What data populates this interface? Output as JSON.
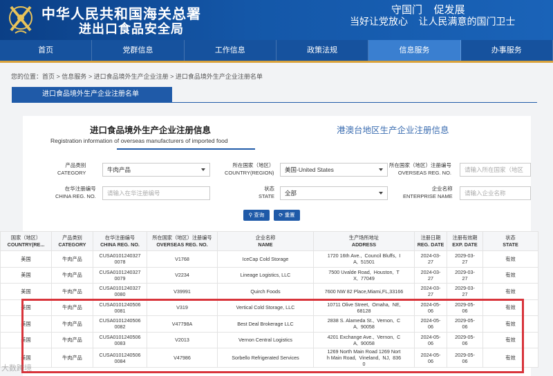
{
  "header": {
    "title_main": "中华人民共和国海关总署",
    "title_sub": "进出口食品安全局",
    "slogan_1": "守国门    促发展",
    "slogan_2": "当好让党放心    让人民满意的国门卫士"
  },
  "nav": {
    "items": [
      "首页",
      "党群信息",
      "工作信息",
      "政策法规",
      "信息服务",
      "办事服务"
    ],
    "active_index": 4
  },
  "breadcrumb": {
    "prefix": "您的位置：",
    "items": [
      "首页",
      "信息服务",
      "进口食品境外生产企业注册",
      "进口食品境外生产企业注册名单"
    ],
    "separator": " > "
  },
  "tab_title": "进口食品境外生产企业注册名单",
  "panel": {
    "tab_active_cn": "进口食品境外生产企业注册信息",
    "tab_active_en": "Registration information of overseas manufacturers of imported food",
    "tab_other": "港澳台地区生产企业注册信息"
  },
  "form": {
    "category_label_cn": "产品类别",
    "category_label_en": "CATEGORY",
    "category_value": "牛肉产品",
    "country_label_cn": "所在国家（地区）",
    "country_label_en": "COUNTRY(REGION)",
    "country_value": "美国-United States",
    "overseas_label_cn": "所在国家（地区）注册编号",
    "overseas_label_en": "OVERSEAS REG. NO.",
    "overseas_placeholder": "请输入所在国家（地区",
    "china_label_cn": "在华注册编号",
    "china_label_en": "CHINA REG. NO.",
    "china_placeholder": "请输入在华注册编号",
    "state_label_cn": "状态",
    "state_label_en": "STATE",
    "state_value": "全部",
    "enterprise_label_cn": "企业名称",
    "enterprise_label_en": "ENTERPRISE NAME",
    "enterprise_placeholder": "请输入企业名称",
    "search_button": "查询",
    "reset_button": "重置"
  },
  "table": {
    "headers": [
      {
        "cn": "国家（地区）",
        "en": "COUNTRY(RE..."
      },
      {
        "cn": "产品类别",
        "en": "CATEGORY"
      },
      {
        "cn": "在华注册编号",
        "en": "CHINA REG. NO."
      },
      {
        "cn": "所在国家（地区）注册编号",
        "en": "OVERSEAS REG. NO."
      },
      {
        "cn": "企业名称",
        "en": "NAME"
      },
      {
        "cn": "生产场所地址",
        "en": "ADDRESS"
      },
      {
        "cn": "注册日期",
        "en": "REG. DATE"
      },
      {
        "cn": "注册有效期",
        "en": "EXP. DATE"
      },
      {
        "cn": "状态",
        "en": "STATE"
      }
    ],
    "rows": [
      {
        "country": "美国",
        "category": "牛肉产品",
        "china_reg": "CUSA0101240327\n0078",
        "overseas_reg": "V1768",
        "name": "IceCap Cold Storage",
        "address": "1720 16th Ave.,  Council Bluffs,  I\nA,  51501",
        "reg_date": "2024-03-\n27",
        "exp_date": "2029-03-\n27",
        "state": "有效"
      },
      {
        "country": "美国",
        "category": "牛肉产品",
        "china_reg": "CUSA0101240327\n0079",
        "overseas_reg": "V2234",
        "name": "Lineage Logistics, LLC",
        "address": "7500 Uvalde Road,  Houston,  T\nX,  77049",
        "reg_date": "2024-03-\n27",
        "exp_date": "2029-03-\n27",
        "state": "有效"
      },
      {
        "country": "美国",
        "category": "牛肉产品",
        "china_reg": "CUSA0101240327\n0080",
        "overseas_reg": "V39991",
        "name": "Quirch Foods",
        "address": "7600 NW 82 Place,Miami,FL,33166",
        "reg_date": "2024-03-\n27",
        "exp_date": "2029-03-\n27",
        "state": "有效"
      },
      {
        "country": "美国",
        "category": "牛肉产品",
        "china_reg": "CUSA0101240506\n0081",
        "overseas_reg": "V319",
        "name": "Vertical Cold Storage, LLC",
        "address": "10711 Olive Street,  Omaha,  NE,\n68128",
        "reg_date": "2024-05-\n06",
        "exp_date": "2029-05-\n06",
        "state": "有效"
      },
      {
        "country": "美国",
        "category": "牛肉产品",
        "china_reg": "CUSA0101240506\n0082",
        "overseas_reg": "V47798A",
        "name": "Best Deal Brokerage LLC",
        "address": "2838 S. Alameda St.,  Vernon,  C\nA,  90058",
        "reg_date": "2024-05-\n06",
        "exp_date": "2029-05-\n06",
        "state": "有效"
      },
      {
        "country": "美国",
        "category": "牛肉产品",
        "china_reg": "CUSA0101240506\n0083",
        "overseas_reg": "V2013",
        "name": "Vernon Central Logistics",
        "address": "4201 Exchange Ave.,  Vernon,  C\nA,  90058",
        "reg_date": "2024-05-\n06",
        "exp_date": "2029-05-\n06",
        "state": "有效"
      },
      {
        "country": "美国",
        "category": "牛肉产品",
        "china_reg": "CUSA0101240506\n0084",
        "overseas_reg": "V47986",
        "name": "Sorbello Refrigerated Services",
        "address": "1269 North Main Road 1269 Nort\nh Main Road,  Vineland,  NJ,  836\n0",
        "reg_date": "2024-05-\n06",
        "exp_date": "2029-05-\n06",
        "state": "有效"
      }
    ]
  },
  "watermark": "大数跨境",
  "colors": {
    "header_blue": "#1457a8",
    "nav_blue": "#16529e",
    "nav_active": "#3a7fd0",
    "accent_gold": "#d9a13a",
    "button_blue": "#1f5aa8",
    "highlight_red": "#d8333a"
  }
}
